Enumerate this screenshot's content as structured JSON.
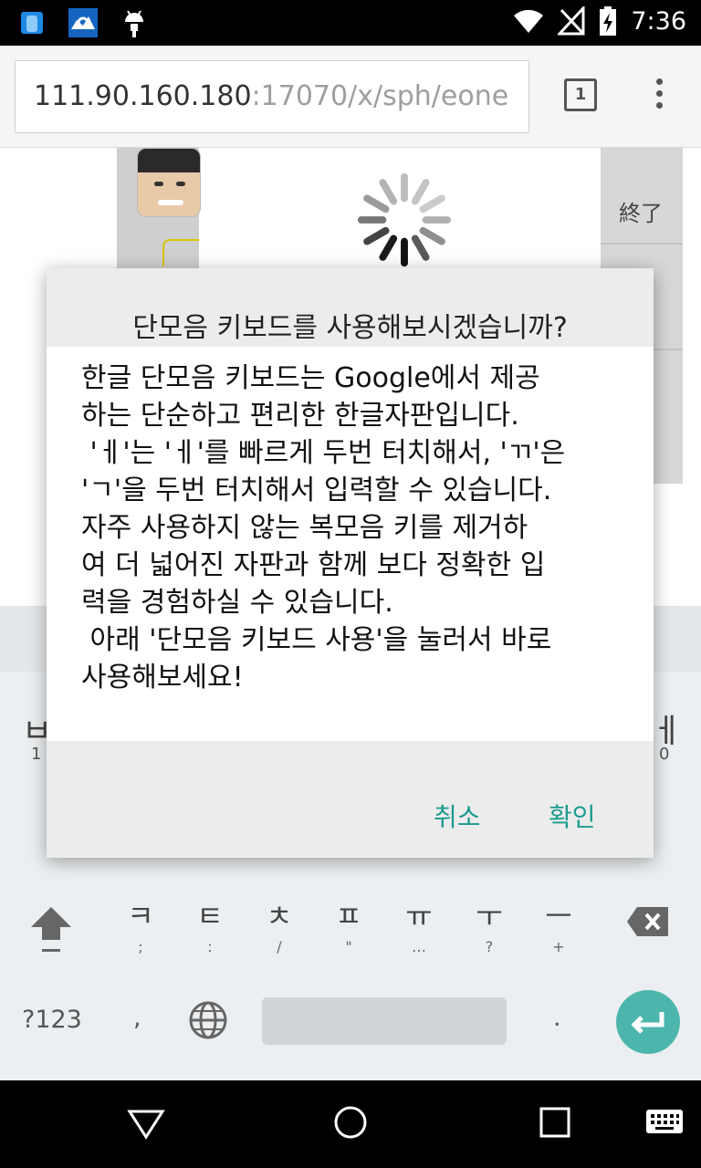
{
  "status_bar": {
    "time": "7:36",
    "left_icons": [
      "app-notification-icon",
      "photos-icon",
      "android-debug-icon"
    ],
    "right_icons": [
      "wifi-icon",
      "no-signal-icon",
      "battery-charging-icon"
    ]
  },
  "browser": {
    "url_host": "111.90.160.180",
    "url_rest": ":17070/x/sph/eone",
    "tab_count": "1"
  },
  "page_behind": {
    "right_label": "終了"
  },
  "dialog": {
    "title": "단모음 키보드를 사용해보시겠습니까?",
    "body": "한글 단모음 키보드는 Google에서 제공\n하는 단순하고 편리한 한글자판입니다.\n 'ㅔ'는 'ㅔ'를 빠르게 두번 터치해서, 'ㄲ'은\n'ㄱ'을 두번 터치해서 입력할 수 있습니다.\n자주 사용하지 않는 복모음 키를 제거하\n여 더 넓어진 자판과 함께 보다 정확한 입\n력을 경험하실 수 있습니다.\n 아래 '단모음 키보드 사용'을 눌러서 바로\n사용해보세요!",
    "cancel_label": "취소",
    "ok_label": "확인"
  },
  "keyboard": {
    "row1_left_hint": "ㅂ",
    "row1_right_hint": "ㅔ",
    "row1_left_num": "1",
    "row1_right_num": "0",
    "row3_keys": [
      {
        "main": "ㅋ",
        "sub": ";"
      },
      {
        "main": "ㅌ",
        "sub": ":"
      },
      {
        "main": "ㅊ",
        "sub": "/"
      },
      {
        "main": "ㅍ",
        "sub": "\""
      },
      {
        "main": "ㅠ",
        "sub": "…"
      },
      {
        "main": "ㅜ",
        "sub": "?"
      },
      {
        "main": "ㅡ",
        "sub": "+"
      }
    ],
    "symbols_label": "?123",
    "comma_label": ",",
    "period_label": "."
  }
}
